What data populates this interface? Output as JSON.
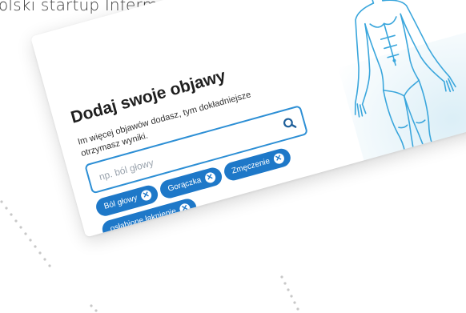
{
  "caption": "olski startup Infermedica.",
  "card": {
    "title": "Dodaj swoje objawy",
    "subtitle": "Im więcej objawów dodasz, tym dokładniejsze otrzymasz wyniki.",
    "search": {
      "placeholder": "np. ból głowy",
      "icon": "search-icon"
    },
    "chips": [
      {
        "label": "Ból głowy"
      },
      {
        "label": "Gorączka"
      },
      {
        "label": "Zmęczenie"
      },
      {
        "label": "osłabione łaknienie"
      }
    ],
    "figure_icon": "human-body-outline"
  },
  "colors": {
    "accent": "#1e78c8",
    "input_border": "#2d8fd5",
    "figure_stroke": "#3aa6dc"
  }
}
